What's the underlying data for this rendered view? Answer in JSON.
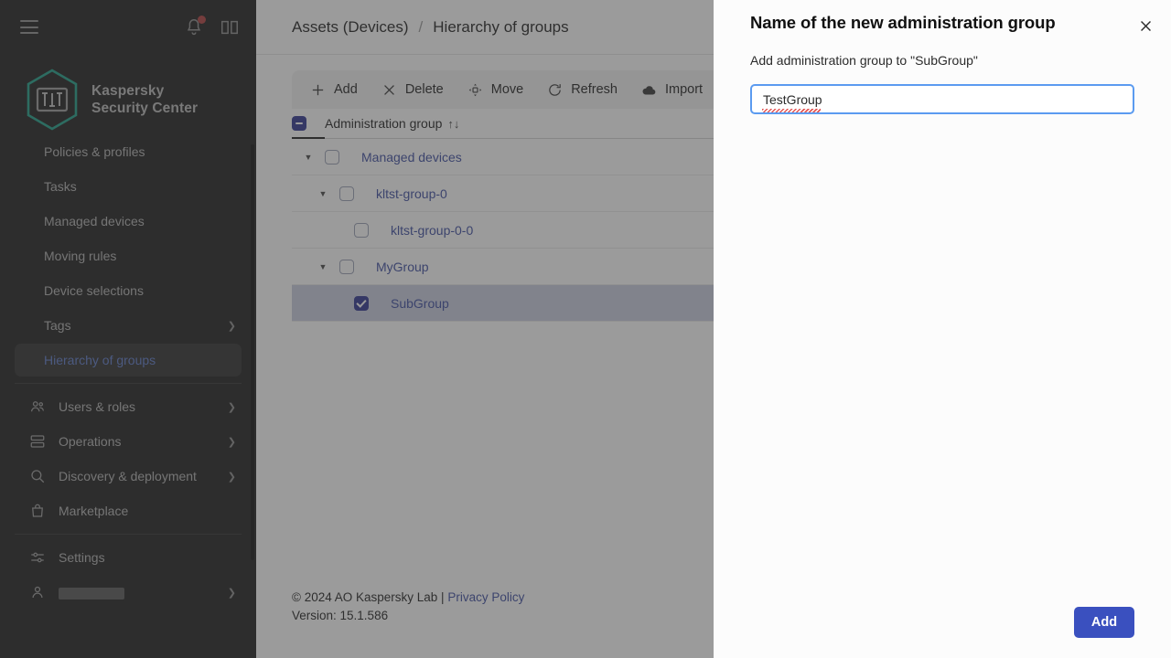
{
  "sidebar": {
    "hamburger_icon": "hamburger-menu-icon",
    "notifications_icon": "bell-icon",
    "help_icon": "book-icon",
    "brand": {
      "line1": "Kaspersky",
      "line2": "Security Center",
      "logo_icon": "kaspersky-hexagon-logo",
      "accent_color": "#1a9e87"
    },
    "items": [
      {
        "label": "Policies & profiles",
        "icon": "",
        "chevron": false,
        "active": false
      },
      {
        "label": "Tasks",
        "icon": "",
        "chevron": false,
        "active": false
      },
      {
        "label": "Managed devices",
        "icon": "",
        "chevron": false,
        "active": false
      },
      {
        "label": "Moving rules",
        "icon": "",
        "chevron": false,
        "active": false
      },
      {
        "label": "Device selections",
        "icon": "",
        "chevron": false,
        "active": false
      },
      {
        "label": "Tags",
        "icon": "",
        "chevron": true,
        "active": false
      },
      {
        "label": "Hierarchy of groups",
        "icon": "",
        "chevron": false,
        "active": true
      },
      {
        "label": "Users & roles",
        "icon": "users-icon",
        "chevron": true,
        "active": false
      },
      {
        "label": "Operations",
        "icon": "stack-icon",
        "chevron": true,
        "active": false
      },
      {
        "label": "Discovery & deployment",
        "icon": "search-icon",
        "chevron": true,
        "active": false
      },
      {
        "label": "Marketplace",
        "icon": "bag-icon",
        "chevron": false,
        "active": false
      },
      {
        "label": "Settings",
        "icon": "sliders-icon",
        "chevron": false,
        "active": false
      },
      {
        "label": "",
        "icon": "user-icon",
        "chevron": true,
        "active": false,
        "redacted": true
      }
    ]
  },
  "breadcrumb": {
    "parent": "Assets (Devices)",
    "separator": "/",
    "current": "Hierarchy of groups"
  },
  "toolbar": {
    "buttons": [
      {
        "label": "Add",
        "icon": "plus-icon"
      },
      {
        "label": "Delete",
        "icon": "close-x-icon"
      },
      {
        "label": "Move",
        "icon": "move-icon"
      },
      {
        "label": "Refresh",
        "icon": "refresh-icon"
      },
      {
        "label": "Import",
        "icon": "cloud-upload-icon"
      }
    ]
  },
  "table": {
    "header_label": "Administration group",
    "sort_icon": "↑↓",
    "header_checkbox_state": "indeterminate",
    "rows": [
      {
        "name": "Managed devices",
        "indent": 0,
        "caret": "▼",
        "checked": false,
        "selected": false
      },
      {
        "name": "kltst-group-0",
        "indent": 1,
        "caret": "▼",
        "checked": false,
        "selected": false
      },
      {
        "name": "kltst-group-0-0",
        "indent": 2,
        "caret": "",
        "checked": false,
        "selected": false
      },
      {
        "name": "MyGroup",
        "indent": 1,
        "caret": "▼",
        "checked": false,
        "selected": false
      },
      {
        "name": "SubGroup",
        "indent": 2,
        "caret": "",
        "checked": true,
        "selected": true
      }
    ]
  },
  "footer": {
    "copyright": "© 2024 AO Kaspersky Lab |",
    "privacy_link": "Privacy Policy",
    "version": "Version: 15.1.586"
  },
  "modal": {
    "title": "Name of the new administration group",
    "subtitle": "Add administration group to \"SubGroup\"",
    "close_icon": "close-x-icon",
    "input_value": "TestGroup",
    "input_placeholder": "",
    "add_label": "Add",
    "accent_color": "#3a50bf",
    "focus_border_color": "#5b9bf0"
  }
}
